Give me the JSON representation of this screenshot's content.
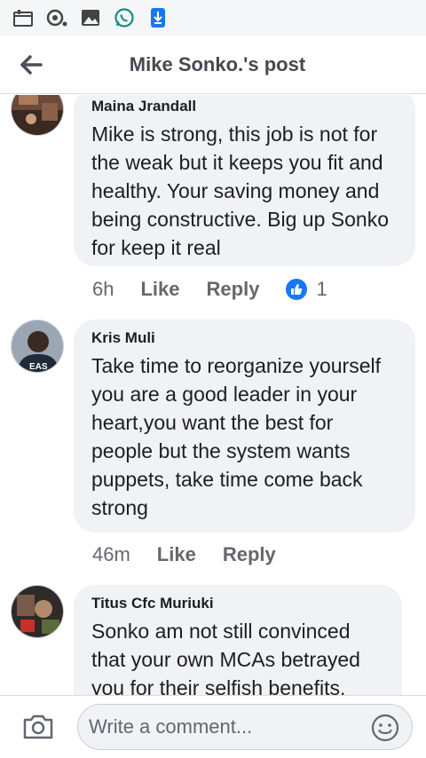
{
  "status_bar": {
    "icons": [
      "calendar-icon",
      "media-icon",
      "gallery-icon",
      "whatsapp-icon",
      "download-icon"
    ]
  },
  "header": {
    "title": "Mike Sonko.'s post",
    "back_icon": "back-arrow-icon"
  },
  "comments": [
    {
      "author": "Maina Jrandall",
      "text": "Mike is strong, this job is not for the weak but it keeps you fit and healthy. Your saving money and being constructive. Big up Sonko for keep it real",
      "time": "6h",
      "like_label": "Like",
      "reply_label": "Reply",
      "reaction_count": "1",
      "reaction_icon": "like-reaction-icon"
    },
    {
      "author": "Kris Muli",
      "text": "Take time to reorganize yourself you are a good leader in your heart,you want the best for people but the system wants puppets, take time come back strong",
      "time": "46m",
      "like_label": "Like",
      "reply_label": "Reply"
    },
    {
      "author": "Titus Cfc Muriuki",
      "text": "Sonko am not still convinced that your own MCAs betrayed you for their selfish benefits."
    }
  ],
  "composer": {
    "placeholder": "Write a comment...",
    "camera_icon": "camera-icon",
    "emoji_icon": "emoji-icon"
  },
  "colors": {
    "accent": "#1877f2",
    "bubble": "#f0f2f5",
    "secondary_text": "#65676b"
  }
}
